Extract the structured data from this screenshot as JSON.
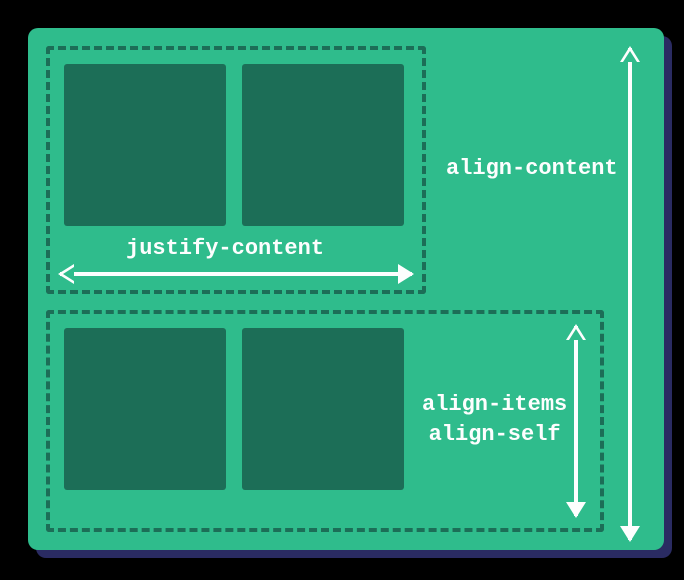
{
  "labels": {
    "justify_content": "justify-content",
    "align_content": "align-content",
    "align_items_self": "align-items\nalign-self"
  },
  "colors": {
    "panel": "#2fbc8c",
    "cell": "#1c6e57",
    "border": "#1c6e57",
    "arrow": "#fdfefe",
    "shadow": "#2a2b62",
    "background": "#000000"
  }
}
